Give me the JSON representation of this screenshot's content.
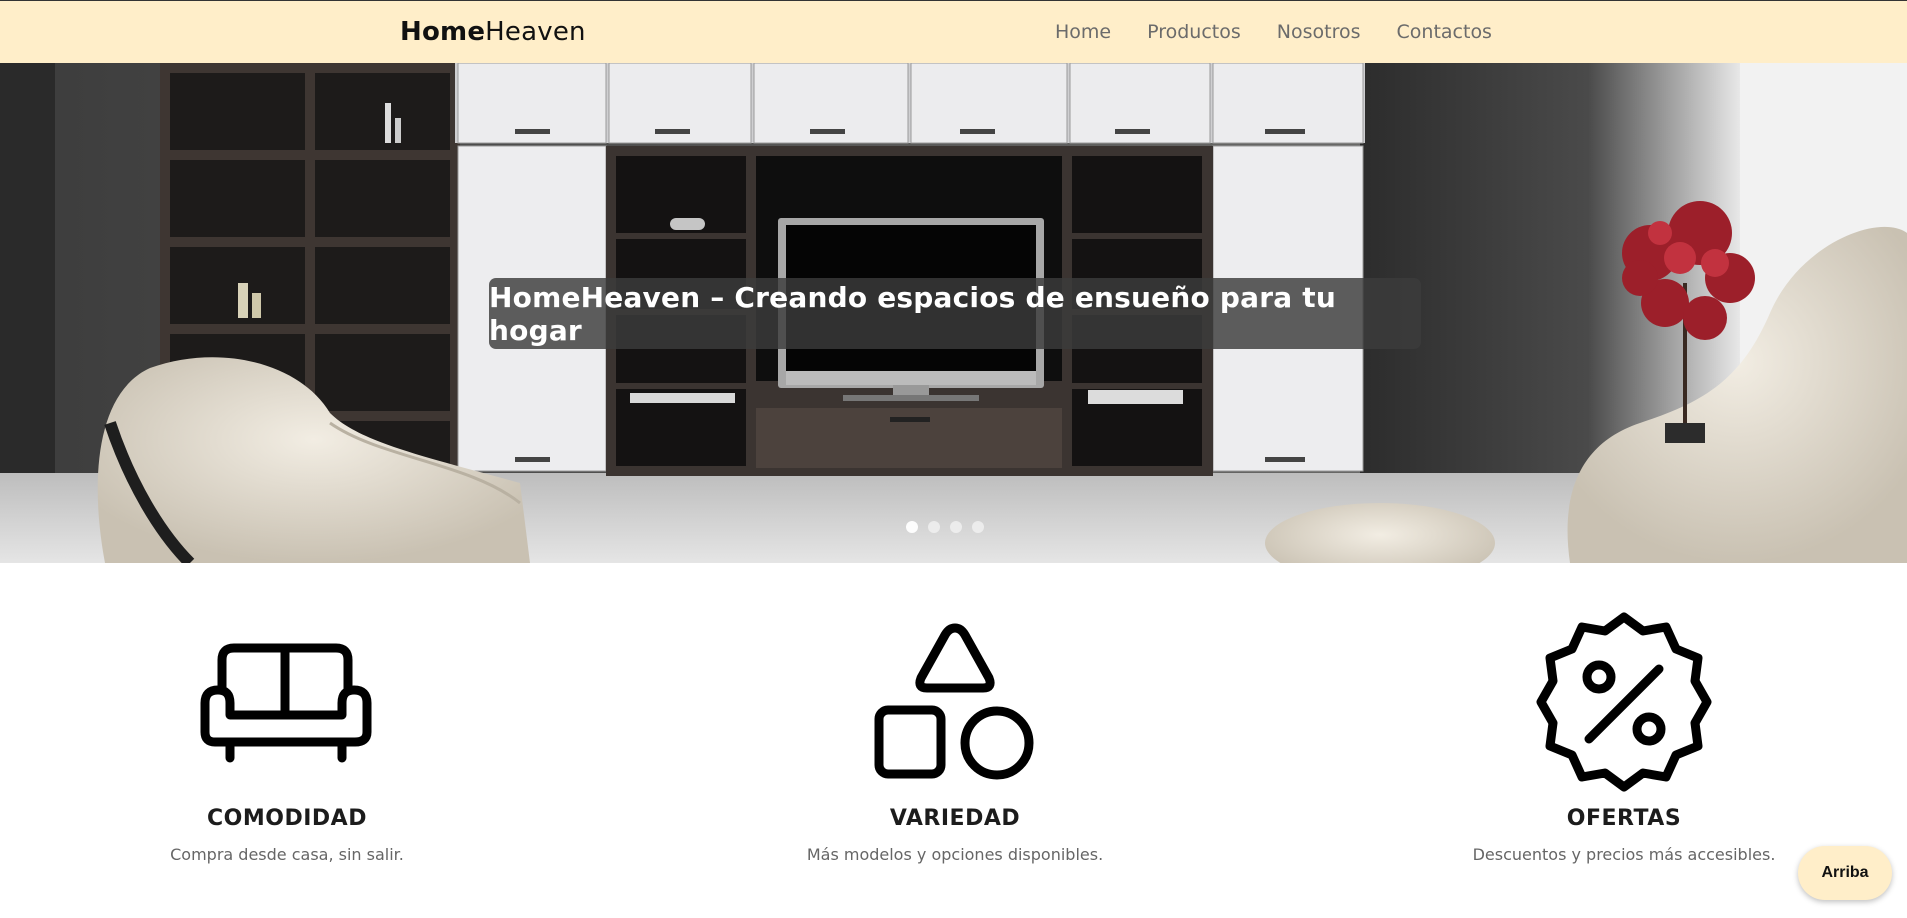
{
  "navbar": {
    "brand_bold": "Home",
    "brand_light": "Heaven",
    "links": [
      {
        "label": "Home"
      },
      {
        "label": "Productos"
      },
      {
        "label": "Nosotros"
      },
      {
        "label": "Contactos"
      }
    ],
    "background": "#ffeec9"
  },
  "hero": {
    "caption": "HomeHeaven – Creando espacios de ensueño para tu hogar",
    "slide_count": 4,
    "active_slide": 1
  },
  "features": [
    {
      "icon": "sofa-icon",
      "title": "COMODIDAD",
      "description": "Compra desde casa, sin salir."
    },
    {
      "icon": "shapes-icon",
      "title": "VARIEDAD",
      "description": "Más modelos y opciones disponibles."
    },
    {
      "icon": "discount-badge-icon",
      "title": "OFERTAS",
      "description": "Descuentos y precios más accesibles."
    }
  ],
  "scroll_top": {
    "label": "Arriba"
  }
}
